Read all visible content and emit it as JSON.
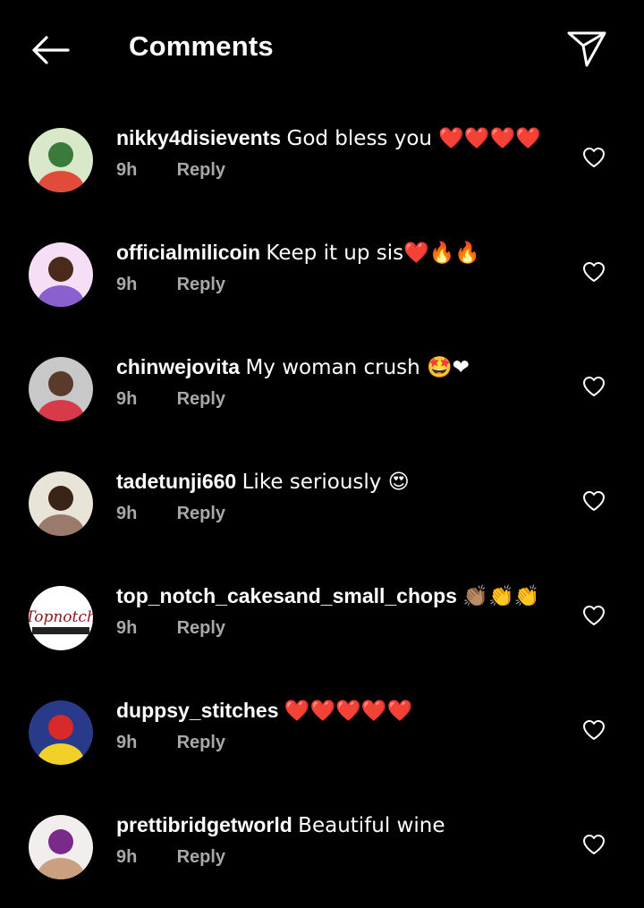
{
  "header": {
    "title": "Comments",
    "back_icon": "arrow-left-icon",
    "share_icon": "paper-plane-icon"
  },
  "comments": [
    {
      "username": "nikky4disievents",
      "text": "God bless you ❤️❤️❤️❤️",
      "time": "9h",
      "reply": "Reply",
      "avatar_text": "",
      "avatar_colors": [
        "#d9e8c8",
        "#3a7a3a",
        "#e24a3a"
      ]
    },
    {
      "username": "officialmilicoin",
      "text": "Keep it up sis❤️🔥🔥",
      "time": "9h",
      "reply": "Reply",
      "avatar_text": "",
      "avatar_colors": [
        "#f6dff6",
        "#4a2a1a",
        "#8a5fd0"
      ]
    },
    {
      "username": "chinwejovita",
      "text": "My woman crush 🤩❤",
      "time": "9h",
      "reply": "Reply",
      "avatar_text": "",
      "avatar_colors": [
        "#c8c8c8",
        "#5a3a2a",
        "#d83a4a"
      ]
    },
    {
      "username": "tadetunji660",
      "text": "Like seriously 😍",
      "time": "9h",
      "reply": "Reply",
      "avatar_text": "",
      "avatar_colors": [
        "#e8e4d8",
        "#3a2418",
        "#9a7a6a"
      ]
    },
    {
      "username": "top_notch_cakesand_small_chops",
      "text": "👏🏽👏👏",
      "time": "9h",
      "reply": "Reply",
      "avatar_text": "Topnotch",
      "avatar_colors": [
        "#ffffff",
        "#8a1a1a",
        "#222222"
      ]
    },
    {
      "username": "duppsy_stitches",
      "text": "❤️❤️❤️❤️❤️",
      "time": "9h",
      "reply": "Reply",
      "avatar_text": "",
      "avatar_colors": [
        "#2a3a8a",
        "#d82a2a",
        "#f2d02a"
      ]
    },
    {
      "username": "prettibridgetworld",
      "text": "Beautiful  wine",
      "time": "9h",
      "reply": "Reply",
      "avatar_text": "",
      "avatar_colors": [
        "#f2eeee",
        "#7a2a8a",
        "#caa080"
      ]
    }
  ],
  "like_icon": "heart-outline-icon"
}
